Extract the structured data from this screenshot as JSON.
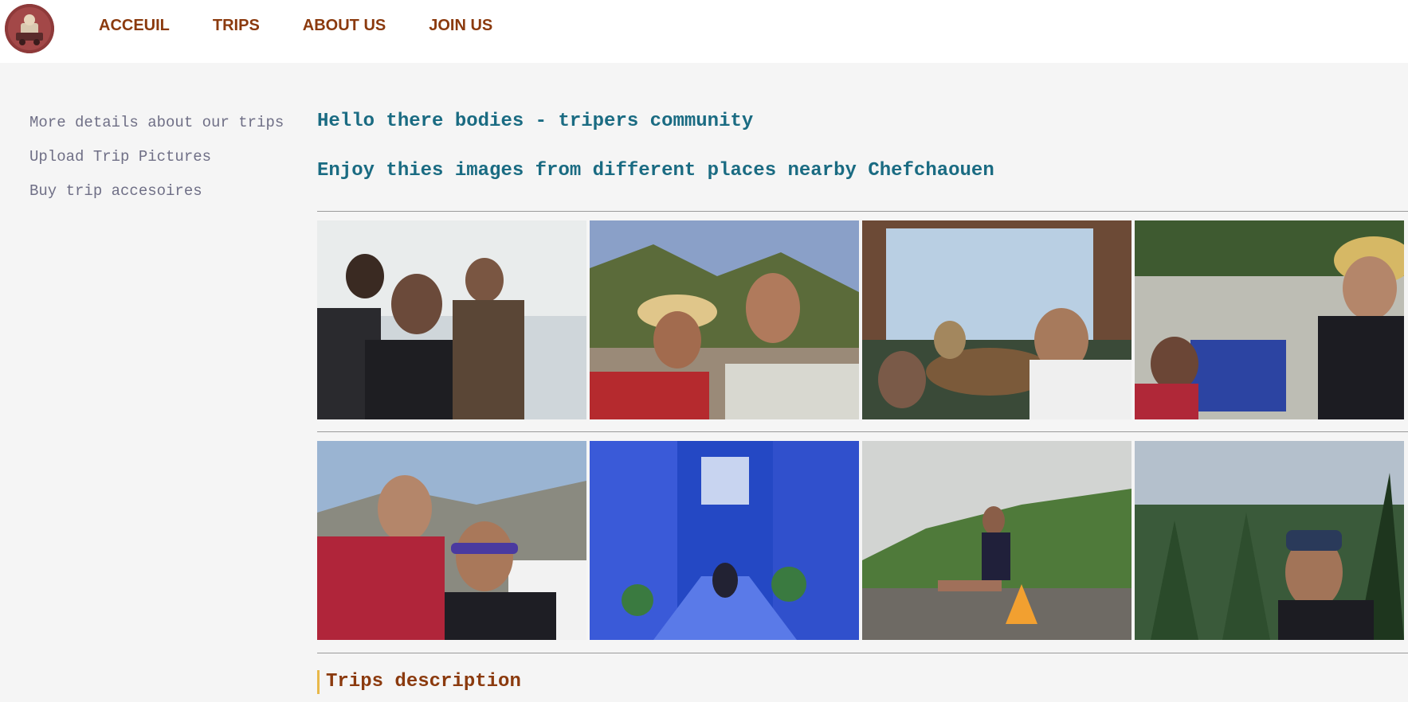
{
  "nav": {
    "items": [
      {
        "label": "ACCEUIL"
      },
      {
        "label": "TRIPS"
      },
      {
        "label": "ABOUT US"
      },
      {
        "label": "JOIN US"
      }
    ]
  },
  "sidebar": {
    "links": [
      {
        "label": "More details about our trips"
      },
      {
        "label": "Upload Trip Pictures"
      },
      {
        "label": "Buy trip accesoires"
      }
    ]
  },
  "main": {
    "title": "Hello there bodies - tripers community",
    "subtitle": "Enjoy thies images from different places nearby Chefchaouen",
    "section_title": "Trips description"
  },
  "colors": {
    "nav_text": "#8b3a0e",
    "heading_text": "#1a6b82",
    "sidebar_text": "#6f6f86",
    "section_accent": "#e8b84a",
    "background": "#f5f5f5"
  }
}
